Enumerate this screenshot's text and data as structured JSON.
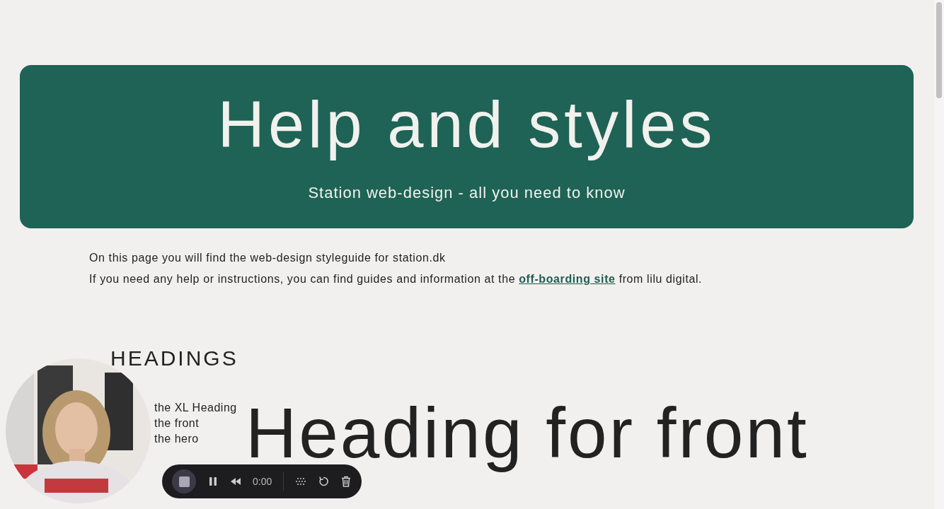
{
  "hero": {
    "title": "Help and styles",
    "subtitle": "Station web-design - all you need to know"
  },
  "intro": {
    "line_1": "On this page you will find the web-design styleguide for station.dk",
    "line_2_before": "If you need any help or instructions, you can find guides and information at the ",
    "link": "off-boarding site",
    "line_2_after": " from lilu digital."
  },
  "section": {
    "title": "HEADINGS",
    "description_lines": [
      "the XL Heading",
      "the front",
      "the hero"
    ],
    "example_heading": "Heading for front"
  },
  "recorder": {
    "time": "0:00"
  }
}
